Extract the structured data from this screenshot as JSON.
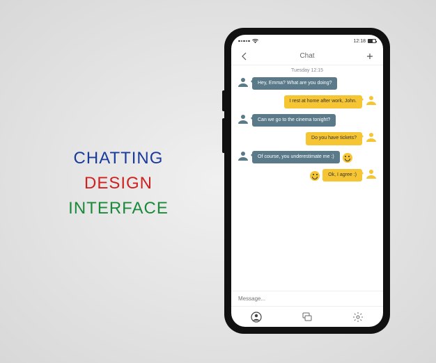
{
  "hero": {
    "line1": "CHATTING",
    "line2": "DESIGN",
    "line3": "INTERFACE"
  },
  "status": {
    "time": "12:18"
  },
  "nav": {
    "title": "Chat"
  },
  "date_label": "Tuesday  12:15",
  "messages": [
    {
      "side": "left",
      "text": "Hey, Emma? What are you doing?"
    },
    {
      "side": "right",
      "text": "I rest at home after work, John."
    },
    {
      "side": "left",
      "text": "Can we go to the cinema tonight?"
    },
    {
      "side": "right",
      "text": "Do you have tickets?"
    },
    {
      "side": "left",
      "text": "Of course, you underestimate me :)",
      "emoji": true
    },
    {
      "side": "right",
      "text": "Ok, I agree :)",
      "emoji_left": true
    }
  ],
  "input": {
    "placeholder": "Message..."
  },
  "colors": {
    "left_bubble": "#5a7a8a",
    "right_bubble": "#f5c533",
    "left_avatar": "#5a7a8a",
    "right_avatar": "#f5c533"
  }
}
